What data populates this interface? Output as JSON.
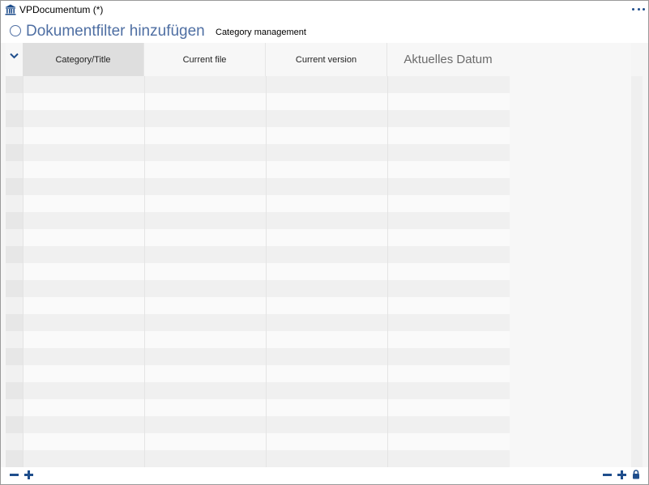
{
  "window": {
    "title": "VPDocumentum",
    "modified_marker": "(*)"
  },
  "header": {
    "filter_link": "Dokumentfilter hinzufügen",
    "subtitle": "Category management"
  },
  "table": {
    "columns": [
      "Category/Title",
      "Current file",
      "Current version",
      "Aktuelles Datum"
    ],
    "row_count": 23
  },
  "icons": {
    "app": "bank-building-icon",
    "more": "more-dots-icon",
    "filter": "circle-icon",
    "collapse": "chevron-down-icon",
    "remove": "minus-icon",
    "add": "plus-icon",
    "lock": "lock-icon"
  },
  "colors": {
    "accent": "#1f4e8c",
    "link": "#4f6fa3",
    "active_header": "#dedede"
  }
}
